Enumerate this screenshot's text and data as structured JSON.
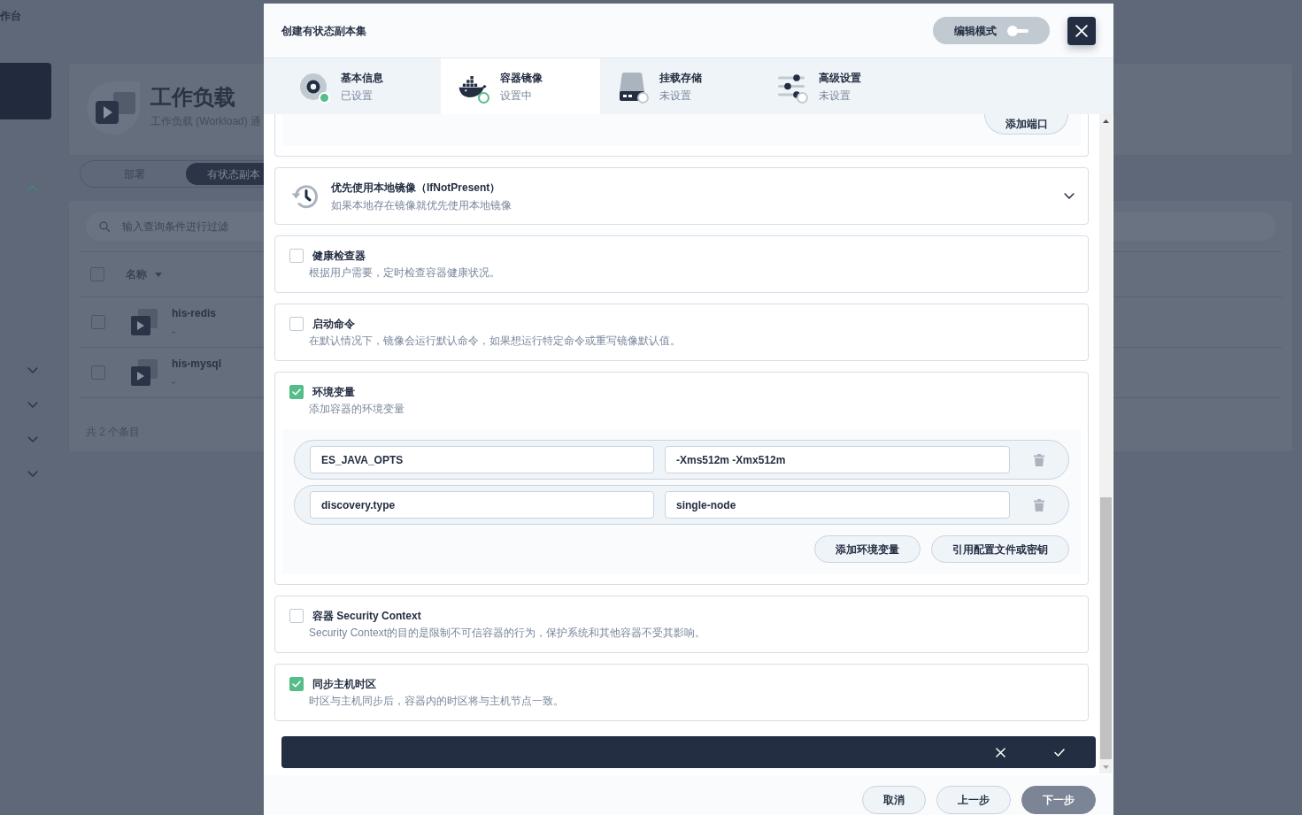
{
  "page": {
    "breadcrumb": "作台",
    "sidebar": {
      "groups": [
        {
          "expanded": true
        },
        {
          "expanded": false
        },
        {
          "expanded": false
        },
        {
          "expanded": false
        },
        {
          "expanded": false
        }
      ]
    },
    "header": {
      "title": "工作负载",
      "subtitle": "工作负载 (Workload) 通"
    },
    "tabs": [
      {
        "label": "部署",
        "selected": false
      },
      {
        "label": "有状态副本",
        "selected": true
      }
    ],
    "search": {
      "placeholder": "输入查询条件进行过滤"
    },
    "table": {
      "all_checked": false,
      "columns": [
        "名称"
      ],
      "rows": [
        {
          "name": "his-redis",
          "description": "-",
          "checked": false
        },
        {
          "name": "his-mysql",
          "description": "-",
          "checked": false
        }
      ],
      "total": "共 2 个条目"
    }
  },
  "dialog": {
    "title": "创建有状态副本集",
    "edit_mode": {
      "label": "编辑模式",
      "on": false
    },
    "steps": [
      {
        "label": "基本信息",
        "status_text": "已设置",
        "done": true,
        "selected": false
      },
      {
        "label": "容器镜像",
        "status_text": "设置中",
        "done": false,
        "selected": true
      },
      {
        "label": "挂载存储",
        "status_text": "未设置",
        "done": false,
        "selected": false
      },
      {
        "label": "高级设置",
        "status_text": "未设置",
        "done": false,
        "selected": false
      }
    ],
    "ports": {
      "add_button": "添加端口"
    },
    "sections": [
      {
        "kind": "select",
        "title": "优先使用本地镜像（IfNotPresent）",
        "description": "如果本地存在镜像就优先使用本地镜像",
        "expanded": false
      },
      {
        "kind": "checkbox",
        "title": "健康检查器",
        "description": "根据用户需要，定时检查容器健康状况。",
        "checked": false
      },
      {
        "kind": "checkbox",
        "title": "启动命令",
        "description": "在默认情况下，镜像会运行默认命令，如果想运行特定命令或重写镜像默认值。",
        "checked": false
      },
      {
        "kind": "checkbox",
        "title": "环境变量",
        "description": "添加容器的环境变量",
        "checked": true,
        "env_vars": [
          {
            "name": "ES_JAVA_OPTS",
            "value": "-Xms512m -Xmx512m"
          },
          {
            "name": "discovery.type",
            "value": "single-node"
          }
        ],
        "actions": [
          "添加环境变量",
          "引用配置文件或密钥"
        ]
      },
      {
        "kind": "checkbox",
        "title": "容器 Security Context",
        "description": "Security Context的目的是限制不可信容器的行为，保护系统和其他容器不受其影响。",
        "checked": false
      },
      {
        "kind": "checkbox",
        "title": "同步主机时区",
        "description": "时区与主机同步后，容器内的时区将与主机节点一致。",
        "checked": true
      }
    ],
    "footer_buttons": [
      {
        "label": "取消",
        "kind": "default",
        "disabled": false
      },
      {
        "label": "上一步",
        "kind": "default",
        "disabled": false
      },
      {
        "label": "下一步",
        "kind": "primary",
        "disabled": true
      }
    ]
  }
}
